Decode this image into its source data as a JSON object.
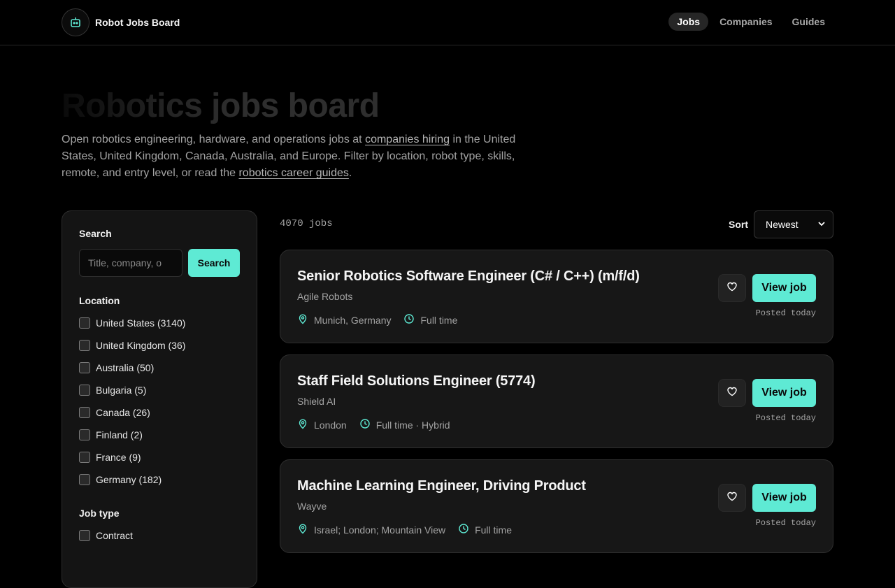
{
  "site": {
    "name": "Robot Jobs Board",
    "logo_icon": "robot-icon"
  },
  "nav": {
    "items": [
      {
        "label": "Jobs",
        "active": true
      },
      {
        "label": "Companies",
        "active": false
      },
      {
        "label": "Guides",
        "active": false
      }
    ]
  },
  "hero": {
    "title": "Robotics jobs board",
    "desc_1": "Open robotics engineering, hardware, and operations jobs at ",
    "link_companies": "companies hiring",
    "desc_2": " in the United States, United Kingdom, Canada, Australia, and Europe. Filter by location, robot type, skills, remote, and entry level, or read the ",
    "link_guides": "robotics career guides",
    "desc_3": "."
  },
  "sidebar": {
    "search_heading": "Search",
    "search_placeholder": "Title, company, o",
    "search_button": "Search",
    "location_heading": "Location",
    "locations": [
      "United States (3140)",
      "United Kingdom (36)",
      "Australia (50)",
      "Bulgaria (5)",
      "Canada (26)",
      "Finland (2)",
      "France (9)",
      "Germany (182)"
    ],
    "job_type_heading": "Job type",
    "job_types": [
      "Contract"
    ]
  },
  "results": {
    "count": "4070 jobs",
    "sort_label": "Sort",
    "sort_value": "Newest"
  },
  "jobs": [
    {
      "title": "Senior Robotics Software Engineer (C# / C++) (m/f/d)",
      "company": "Agile Robots",
      "location": "Munich, Germany",
      "type": "Full time",
      "cta": "View job",
      "posted": "Posted today"
    },
    {
      "title": "Staff Field Solutions Engineer (5774)",
      "company": "Shield AI",
      "location": "London",
      "type": "Full time · Hybrid",
      "cta": "View job",
      "posted": "Posted today"
    },
    {
      "title": "Machine Learning Engineer, Driving Product",
      "company": "Wayve",
      "location": "Israel; London; Mountain View",
      "type": "Full time",
      "cta": "View job",
      "posted": "Posted today"
    }
  ],
  "colors": {
    "accent": "#5eead4",
    "background": "#000000",
    "card": "#171717"
  }
}
